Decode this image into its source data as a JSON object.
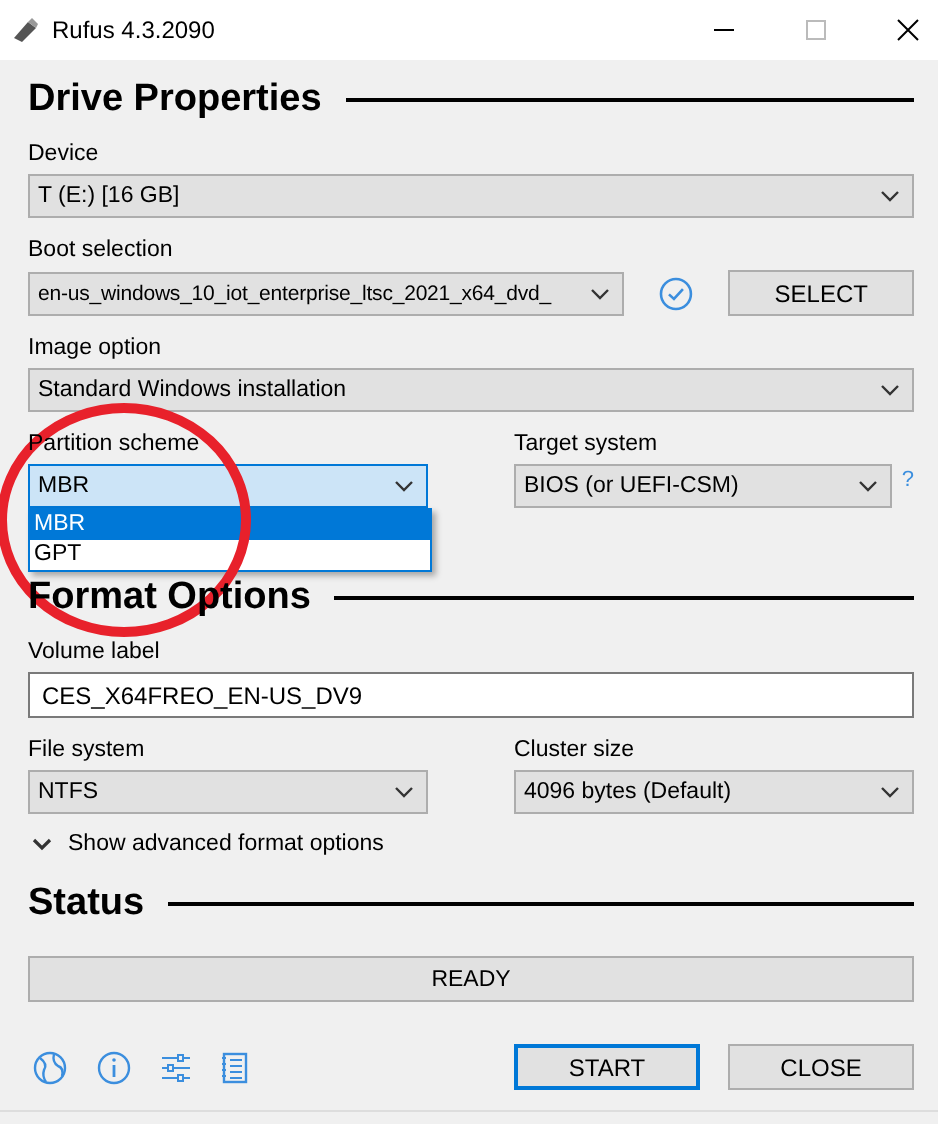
{
  "window": {
    "title": "Rufus 4.3.2090"
  },
  "drive_properties": {
    "heading": "Drive Properties",
    "device": {
      "label": "Device",
      "value": "T (E:) [16 GB]"
    },
    "boot_selection": {
      "label": "Boot selection",
      "value": "en-us_windows_10_iot_enterprise_ltsc_2021_x64_dvd_",
      "verified": true,
      "button": "SELECT"
    },
    "image_option": {
      "label": "Image option",
      "value": "Standard Windows installation"
    },
    "partition_scheme": {
      "label": "Partition scheme",
      "value": "MBR",
      "expanded": true,
      "options": [
        {
          "label": "MBR",
          "selected": true
        },
        {
          "label": "GPT",
          "selected": false
        }
      ]
    },
    "target_system": {
      "label": "Target system",
      "value": "BIOS (or UEFI-CSM)",
      "help": "?"
    }
  },
  "format_options": {
    "heading": "Format Options",
    "volume_label": {
      "label": "Volume label",
      "value": "CES_X64FREO_EN-US_DV9"
    },
    "file_system": {
      "label": "File system",
      "value": "NTFS"
    },
    "cluster_size": {
      "label": "Cluster size",
      "value": "4096 bytes (Default)"
    },
    "advanced": {
      "label": "Show advanced format options",
      "expanded": false
    }
  },
  "status": {
    "heading": "Status",
    "text": "READY"
  },
  "buttons": [
    {
      "label": "START",
      "focused": true
    },
    {
      "label": "CLOSE",
      "focused": false
    }
  ],
  "annotation": {
    "kind": "circle"
  }
}
